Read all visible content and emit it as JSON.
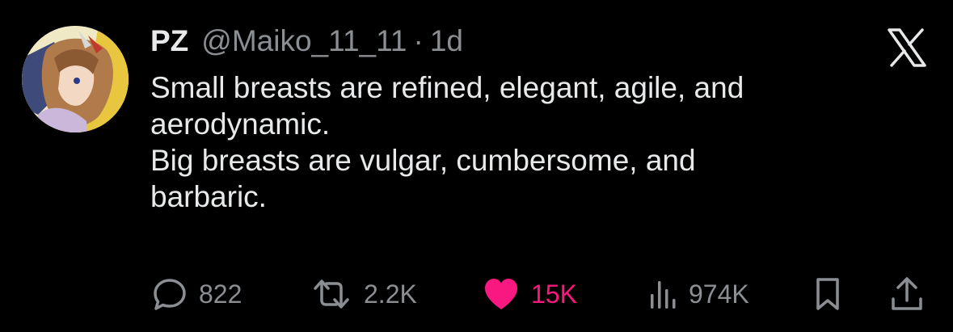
{
  "tweet": {
    "display_name": "PZ",
    "handle": "@Maiko_11_11",
    "separator": "·",
    "time": "1d",
    "platform_icon": "x-logo-icon",
    "text_lines": [
      "Small breasts are refined, elegant, agile, and",
      "aerodynamic.",
      "Big breasts are vulgar, cumbersome, and",
      "barbaric."
    ]
  },
  "actions": {
    "reply": {
      "icon": "reply-icon",
      "count": "822"
    },
    "retweet": {
      "icon": "retweet-icon",
      "count": "2.2K"
    },
    "like": {
      "icon": "heart-icon",
      "count": "15K",
      "liked": true
    },
    "views": {
      "icon": "views-icon",
      "count": "974K"
    },
    "bookmark": {
      "icon": "bookmark-icon"
    },
    "share": {
      "icon": "share-icon"
    }
  },
  "colors": {
    "background": "#000000",
    "text_primary": "#e7e9ea",
    "text_secondary": "#8b8f94",
    "like_accent": "#f91880"
  }
}
